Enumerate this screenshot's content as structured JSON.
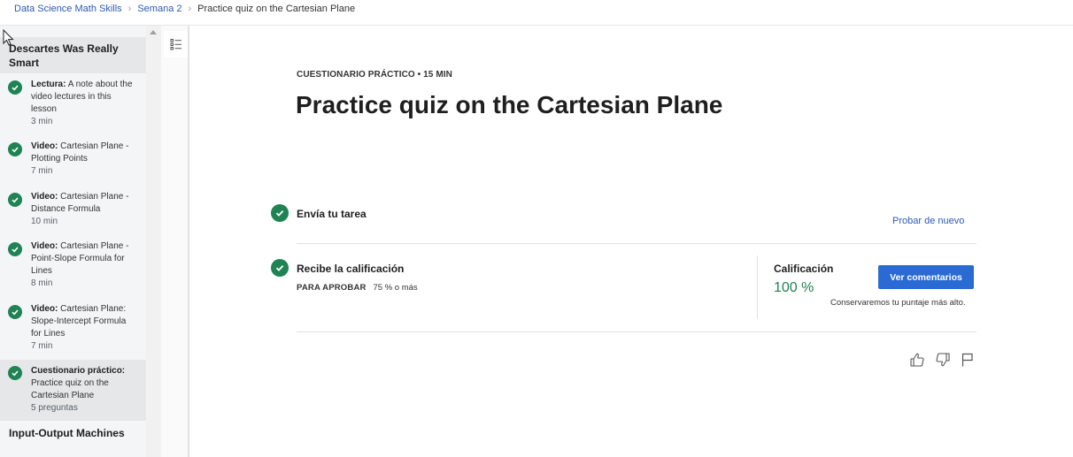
{
  "breadcrumb": {
    "course": "Data Science Math Skills",
    "week": "Semana 2",
    "current": "Practice quiz on the Cartesian Plane"
  },
  "sidebar": {
    "section_1": "Descartes Was Really Smart",
    "items": [
      {
        "kind": "Lectura:",
        "title": "A note about the video lectures in this lesson",
        "meta": "3 min"
      },
      {
        "kind": "Video:",
        "title": "Cartesian Plane - Plotting Points",
        "meta": "7 min"
      },
      {
        "kind": "Video:",
        "title": "Cartesian Plane - Distance Formula",
        "meta": "10 min"
      },
      {
        "kind": "Video:",
        "title": "Cartesian Plane - Point-Slope Formula for Lines",
        "meta": "8 min"
      },
      {
        "kind": "Video:",
        "title": "Cartesian Plane: Slope-Intercept Formula for Lines",
        "meta": "7 min"
      },
      {
        "kind": "Cuestionario práctico:",
        "title": "Practice quiz on the Cartesian Plane",
        "meta": "5 preguntas"
      }
    ],
    "section_2": "Input-Output Machines"
  },
  "main": {
    "eyebrow": "CUESTIONARIO PRÁCTICO • 15 MIN",
    "title": "Practice quiz on the Cartesian Plane",
    "step_submit": "Envía tu tarea",
    "retry": "Probar de nuevo",
    "step_grade": "Recibe la calificación",
    "pass_label": "PARA APROBAR",
    "pass_value": "75 % o más",
    "grade_label": "Calificación",
    "grade_value": "100 %",
    "feedback_button": "Ver comentarios",
    "keep_note": "Conservaremos tu puntaje más alto."
  },
  "colors": {
    "accent": "#2a6ad3",
    "success": "#1f8354",
    "link": "#2a5bb5"
  },
  "icons": [
    "checkmark-icon",
    "outline-list-icon",
    "thumbs-up-icon",
    "thumbs-down-icon",
    "flag-icon",
    "mouse-cursor-icon"
  ]
}
